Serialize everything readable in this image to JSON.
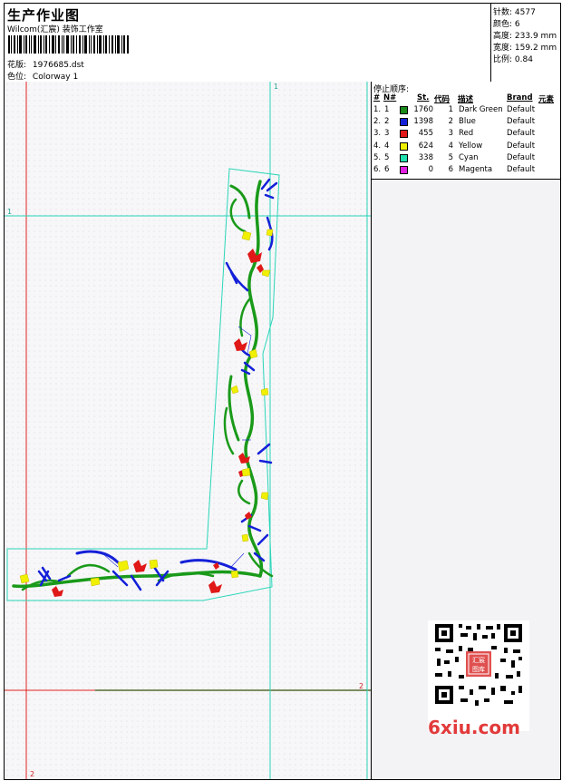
{
  "header": {
    "title": "生产作业图",
    "studio": "Wilcom(汇宸) 装饰工作室",
    "design_label": "花版:",
    "design_file": "1976685.dst",
    "colorway_label": "色位:",
    "colorway": "Colorway 1"
  },
  "stats": {
    "stitches_label": "针数:",
    "stitches": "4577",
    "colors_label": "颜色:",
    "colors": "6",
    "height_label": "高度:",
    "height": "233.9 mm",
    "width_label": "宽度:",
    "width": "159.2 mm",
    "scale_label": "比例:",
    "scale": "0.84"
  },
  "color_table": {
    "title": "停止顺序:",
    "headers": [
      "#",
      "N#",
      "St.",
      "代码",
      "描述",
      "Brand",
      "元素"
    ],
    "rows": [
      {
        "idx": "1.",
        "n": "1",
        "color": "#1a8a1a",
        "st": "1760",
        "code": "1",
        "desc": "Dark Green",
        "brand": "Default"
      },
      {
        "idx": "2.",
        "n": "2",
        "color": "#1420d8",
        "st": "1398",
        "code": "2",
        "desc": "Blue",
        "brand": "Default"
      },
      {
        "idx": "3.",
        "n": "3",
        "color": "#e01818",
        "st": "455",
        "code": "3",
        "desc": "Red",
        "brand": "Default"
      },
      {
        "idx": "4.",
        "n": "4",
        "color": "#f0f000",
        "st": "624",
        "code": "4",
        "desc": "Yellow",
        "brand": "Default"
      },
      {
        "idx": "5.",
        "n": "5",
        "color": "#20e0b0",
        "st": "338",
        "code": "5",
        "desc": "Cyan",
        "brand": "Default"
      },
      {
        "idx": "6.",
        "n": "6",
        "color": "#e020e0",
        "st": "0",
        "code": "6",
        "desc": "Magenta",
        "brand": "Default"
      }
    ]
  },
  "guides": {
    "label_top": "1",
    "label_left": "1",
    "label_right": "2",
    "label_bottom": "2"
  },
  "watermark": {
    "site": "6xiu.com",
    "seal": "汇宸图库"
  }
}
